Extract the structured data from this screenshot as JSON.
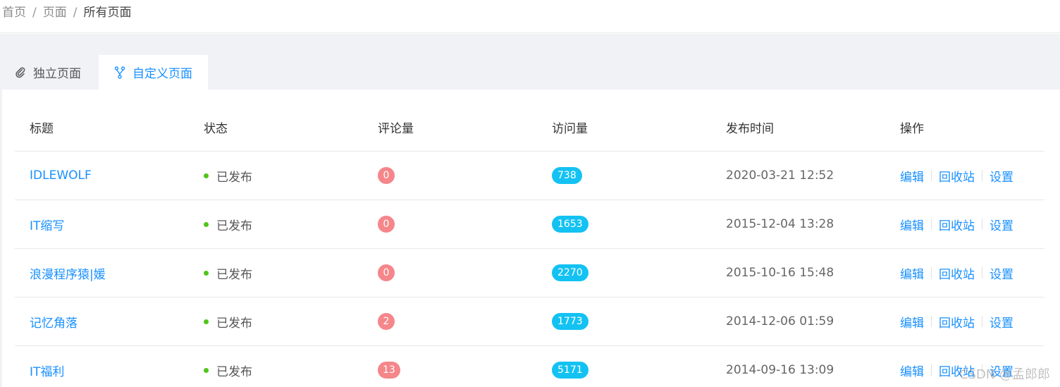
{
  "breadcrumb": {
    "items": [
      "首页",
      "页面",
      "所有页面"
    ]
  },
  "tabs": [
    {
      "label": "独立页面",
      "icon": "paperclip-icon"
    },
    {
      "label": "自定义页面",
      "icon": "branch-icon"
    }
  ],
  "table": {
    "headers": [
      "标题",
      "状态",
      "评论量",
      "访问量",
      "发布时间",
      "操作"
    ],
    "rows": [
      {
        "title": "IDLEWOLF",
        "status": "已发布",
        "comments": "0",
        "views": "738",
        "date": "2020-03-21 12:52"
      },
      {
        "title": "IT缩写",
        "status": "已发布",
        "comments": "0",
        "views": "1653",
        "date": "2015-12-04 13:28"
      },
      {
        "title": "浪漫程序猿|媛",
        "status": "已发布",
        "comments": "0",
        "views": "2270",
        "date": "2015-10-16 15:48"
      },
      {
        "title": "记忆角落",
        "status": "已发布",
        "comments": "2",
        "views": "1773",
        "date": "2014-12-06 01:59"
      },
      {
        "title": "IT福利",
        "status": "已发布",
        "comments": "13",
        "views": "5171",
        "date": "2014-09-16 13:09"
      }
    ],
    "actions": {
      "edit": "编辑",
      "recycle": "回收站",
      "settings": "设置"
    }
  },
  "watermark": "CSDN @孟郎郎",
  "colors": {
    "primary": "#1890ff",
    "comment_badge": "#f5868a",
    "view_badge": "#13c2f2",
    "status_dot": "#52c41a"
  }
}
